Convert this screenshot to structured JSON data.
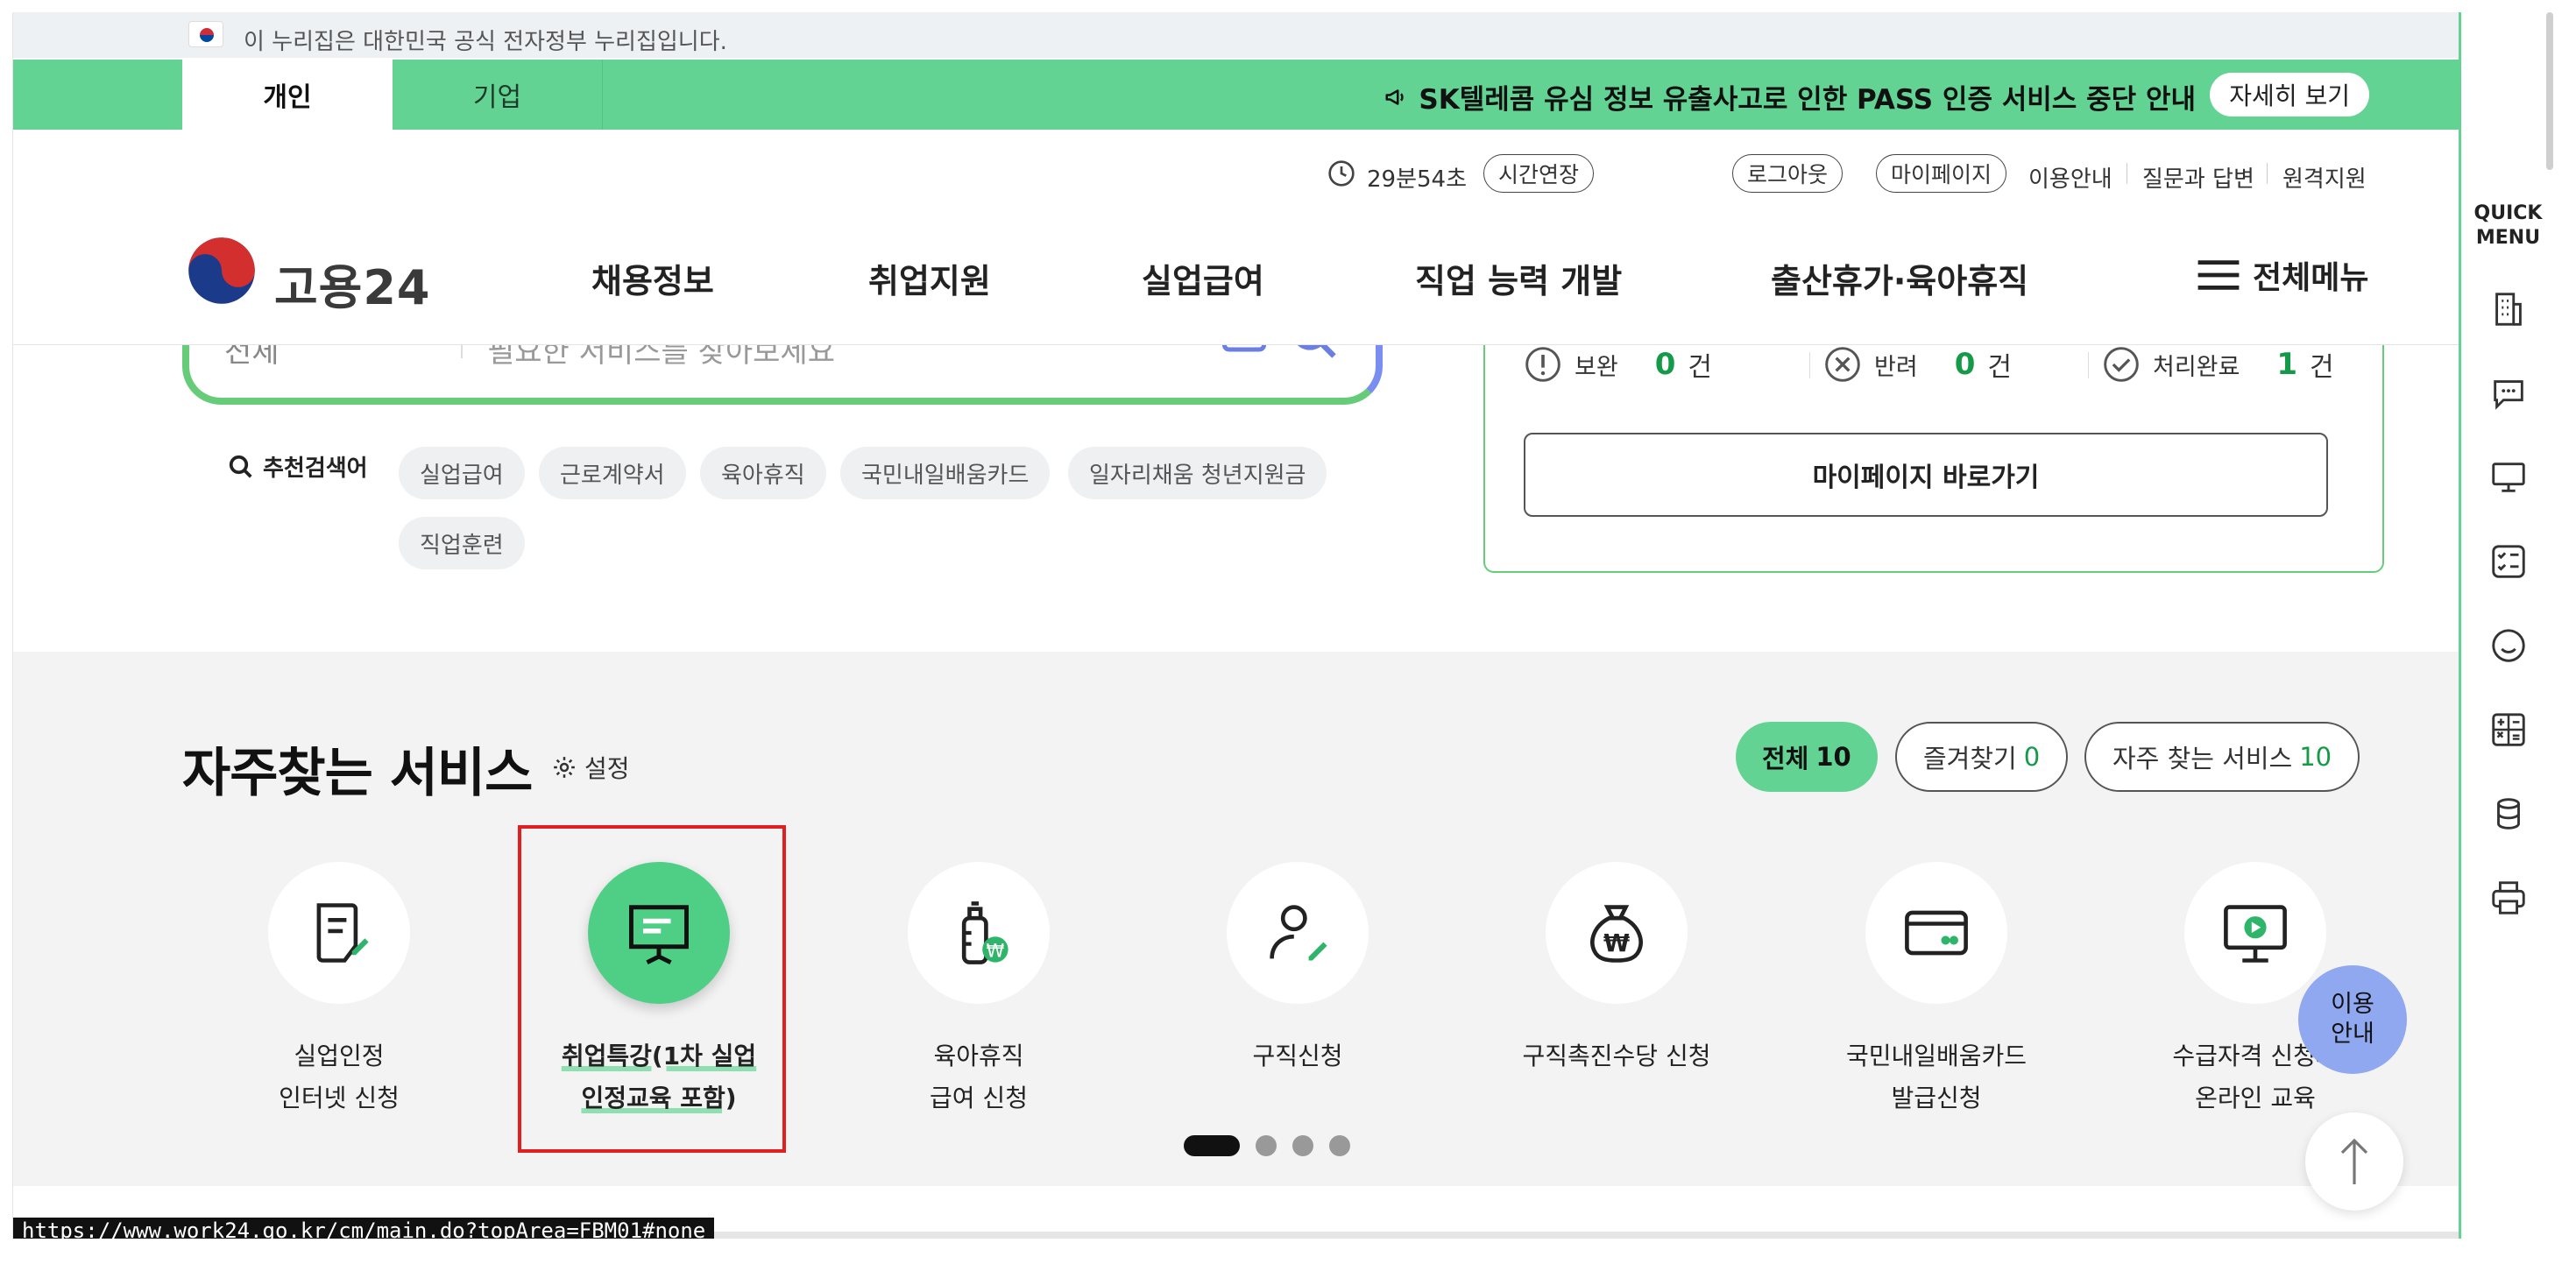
{
  "gov_banner": {
    "text": "이 누리집은 대한민국 공식 전자정부 누리집입니다."
  },
  "topbar": {
    "tabs": [
      {
        "label": "개인"
      },
      {
        "label": "기업"
      }
    ],
    "notice": "SK텔레콤 유심 정보 유출사고로 인한 PASS 인증 서비스 중단 안내",
    "detail_button": "자세히 보기"
  },
  "util": {
    "timer": "29분54초",
    "extend": "시간연장",
    "logout": "로그아웃",
    "mypage": "마이페이지",
    "links": [
      "이용안내",
      "질문과 답변",
      "원격지원"
    ]
  },
  "nav": {
    "logo_text": "고용24",
    "items": [
      "채용정보",
      "취업지원",
      "실업급여",
      "직업 능력 개발",
      "출산휴가·육아휴직"
    ],
    "all_menu": "전체메뉴"
  },
  "search": {
    "category": "전체",
    "placeholder": "필요한 서비스를 찾아보세요"
  },
  "recommend": {
    "label": "추천검색어",
    "keywords": [
      "실업급여",
      "근로계약서",
      "육아휴직",
      "국민내일배움카드",
      "일자리채움 청년지원금",
      "직업훈련"
    ]
  },
  "status": {
    "items": [
      {
        "label": "보완",
        "count": "0",
        "unit": "건"
      },
      {
        "label": "반려",
        "count": "0",
        "unit": "건"
      },
      {
        "label": "처리완료",
        "count": "1",
        "unit": "건"
      }
    ],
    "mypage_go": "마이페이지 바로가기"
  },
  "frequent": {
    "title": "자주찾는 서비스",
    "settings": "설정",
    "filters": [
      {
        "label": "전체",
        "count": "10"
      },
      {
        "label": "즐겨찾기",
        "count": "0"
      },
      {
        "label": "자주 찾는 서비스",
        "count": "10"
      }
    ],
    "services": [
      {
        "label": "실업인정\n인터넷 신청",
        "icon": "document-pen-icon"
      },
      {
        "label": "취업특강(1차 실업\n인정교육 포함)",
        "icon": "presentation-icon"
      },
      {
        "label": "육아휴직\n급여 신청",
        "icon": "baby-bottle-icon"
      },
      {
        "label": "구직신청",
        "icon": "person-pen-icon"
      },
      {
        "label": "구직촉진수당 신청",
        "icon": "money-bag-icon"
      },
      {
        "label": "국민내일배움카드\n발급신청",
        "icon": "card-icon"
      },
      {
        "label": "수급자격 신청자\n온라인 교육",
        "icon": "monitor-play-icon"
      }
    ],
    "page_count": 4,
    "active_page": 1
  },
  "guide_bubble": "이용\n안내",
  "quick_menu": {
    "title": "QUICK\nMENU",
    "icons": [
      "building-icon",
      "chat-icon",
      "monitor-icon",
      "checklist-icon",
      "smile-icon",
      "calculator-icon",
      "coins-icon",
      "printer-icon"
    ]
  },
  "status_url": "https://www.work24.go.kr/cm/main.do?topArea=FBM01#none",
  "colors": {
    "brand_green": "#63d393",
    "count_green": "#149a48",
    "highlight_red": "#e02020",
    "guide_blue": "#8fa8ef"
  }
}
